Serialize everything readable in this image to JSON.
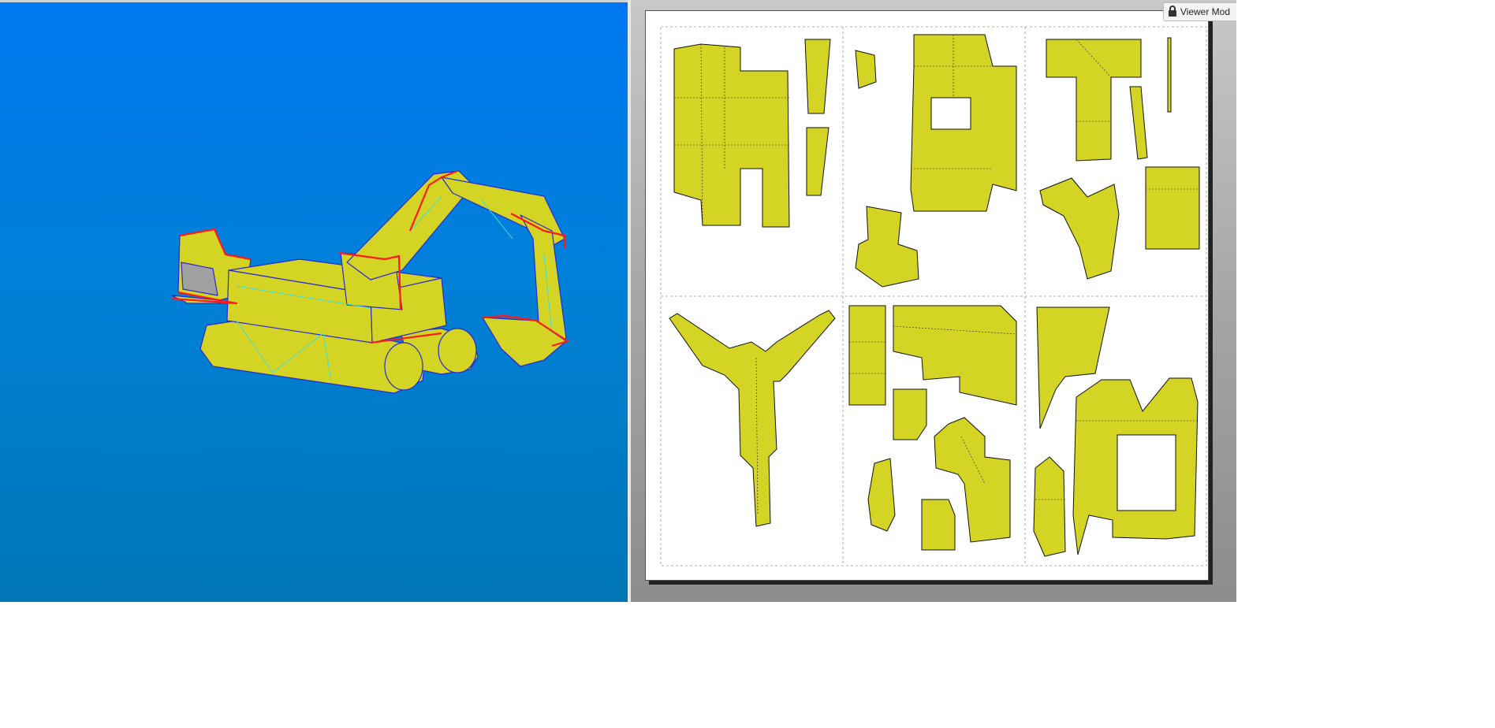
{
  "viewer_badge": {
    "label": "Viewer Mod",
    "icon": "lock-icon"
  },
  "colors": {
    "model_fill": "#d4d424",
    "model_edge": "#2a2ad0",
    "fold_line": "#38e0e0",
    "cut_edge": "#ff1a1a",
    "background_top": "#0078f0",
    "background_bottom": "#0076b6",
    "part_fill": "#d4d424",
    "part_shadow": "#c8c8c8"
  },
  "sheet": {
    "grid_columns": 3,
    "grid_rows": 2
  }
}
